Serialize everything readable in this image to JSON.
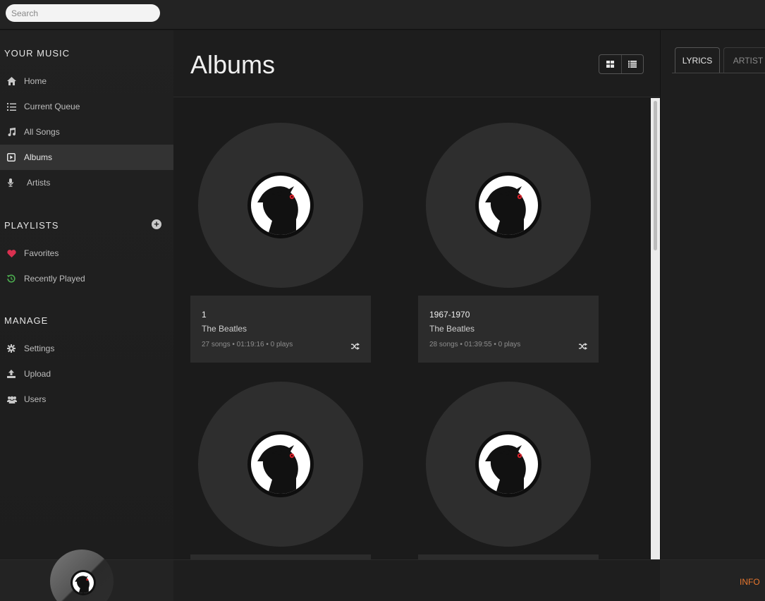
{
  "search": {
    "placeholder": "Search"
  },
  "sidebar": {
    "your_music_heading": "YOUR MUSIC",
    "music_items": [
      {
        "label": "Home",
        "icon": "home-icon"
      },
      {
        "label": "Current Queue",
        "icon": "queue-list-icon"
      },
      {
        "label": "All Songs",
        "icon": "music-note-icon"
      },
      {
        "label": "Albums",
        "icon": "album-icon",
        "active": true
      },
      {
        "label": "Artists",
        "icon": "microphone-icon"
      }
    ],
    "playlists_heading": "PLAYLISTS",
    "playlist_items": [
      {
        "label": "Favorites",
        "icon": "heart-icon",
        "color": "#d9304f"
      },
      {
        "label": "Recently Played",
        "icon": "history-icon",
        "color": "#4caf50"
      }
    ],
    "manage_heading": "MANAGE",
    "manage_items": [
      {
        "label": "Settings",
        "icon": "gear-icon"
      },
      {
        "label": "Upload",
        "icon": "upload-icon"
      },
      {
        "label": "Users",
        "icon": "users-icon"
      }
    ]
  },
  "main": {
    "title": "Albums",
    "view_modes": [
      "grid-view-icon",
      "list-view-icon"
    ],
    "albums": [
      {
        "title": "1",
        "artist": "The Beatles",
        "meta": "27 songs • 01:19:16 • 0 plays"
      },
      {
        "title": "1967-1970",
        "artist": "The Beatles",
        "meta": "28 songs • 01:39:55 • 0 plays"
      },
      {
        "title": "",
        "artist": "",
        "meta": ""
      },
      {
        "title": "",
        "artist": "",
        "meta": ""
      }
    ]
  },
  "right_panel": {
    "tabs": [
      "LYRICS",
      "ARTIST"
    ]
  },
  "player": {
    "info_label": "INFO"
  },
  "colors": {
    "accent": "#e8772e",
    "favorite": "#d9304f",
    "recent": "#4caf50",
    "active_item": "#333333"
  }
}
